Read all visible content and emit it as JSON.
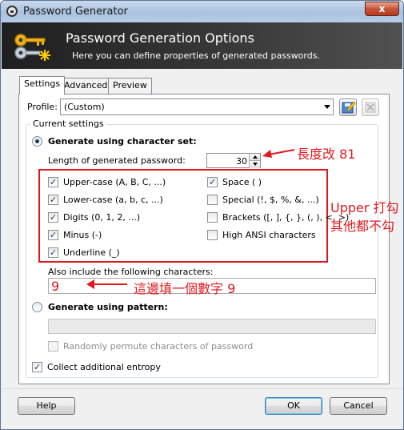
{
  "window": {
    "title": "Password Generator",
    "close_glyph": "x"
  },
  "banner": {
    "title": "Password Generation Options",
    "subtitle": "Here you can define properties of generated passwords."
  },
  "tabs": [
    {
      "label": "Settings",
      "active": true
    },
    {
      "label": "Advanced",
      "active": false
    },
    {
      "label": "Preview",
      "active": false
    }
  ],
  "profile": {
    "label": "Profile:",
    "value": "(Custom)"
  },
  "current_settings": {
    "group_label": "Current settings",
    "mode_charset_label": "Generate using character set:",
    "length_label": "Length of generated password:",
    "length_value": "30",
    "options_left": [
      {
        "label": "Upper-case (A, B, C, ...)",
        "checked": true
      },
      {
        "label": "Lower-case (a, b, c, ...)",
        "checked": true
      },
      {
        "label": "Digits (0, 1, 2, ...)",
        "checked": true
      },
      {
        "label": "Minus (-)",
        "checked": true
      },
      {
        "label": "Underline (_)",
        "checked": true
      }
    ],
    "options_right": [
      {
        "label": "Space ( )",
        "checked": true
      },
      {
        "label": "Special (!, $, %, &, ...)",
        "checked": false
      },
      {
        "label": "Brackets ([, ], {, }, (, ), <, >)",
        "checked": false
      },
      {
        "label": "High ANSI characters",
        "checked": false
      }
    ],
    "also_include_label": "Also include the following characters:",
    "also_include_value": "9",
    "mode_pattern_label": "Generate using pattern:",
    "pattern_value": "",
    "permute_label": "Randomly permute characters of password",
    "permute_checked": false
  },
  "entropy": {
    "label": "Collect additional entropy",
    "checked": true
  },
  "buttons": {
    "help": "Help",
    "ok": "OK",
    "cancel": "Cancel"
  },
  "annotations": {
    "length": "長度改 81",
    "upper_line1": "Upper 打勾",
    "upper_line2": "其他都不勾",
    "digit": "這邊填一個數字 9",
    "color": "#e0191f"
  },
  "icons": {
    "profile_save": "save-profile-icon",
    "profile_delete": "delete-profile-icon",
    "banner": "keys-icon"
  },
  "colors": {
    "banner_bg": "#2b2b2b",
    "title_bar": "#b8cde6",
    "annotation": "#e0191f"
  }
}
